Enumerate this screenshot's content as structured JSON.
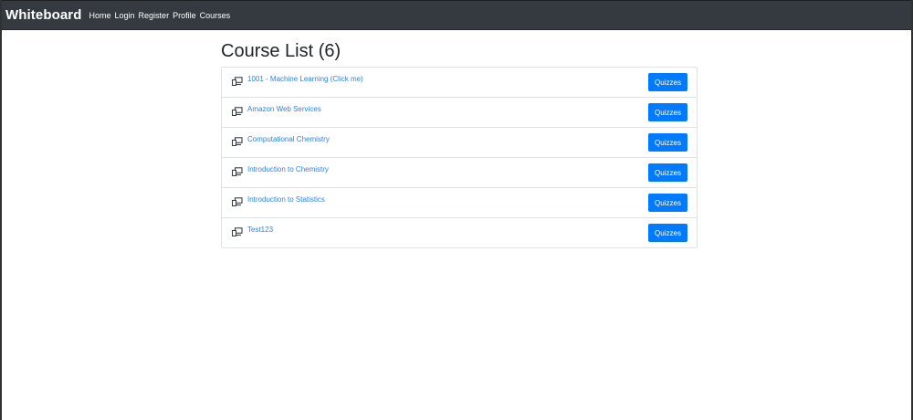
{
  "navbar": {
    "brand": "Whiteboard",
    "links": [
      "Home",
      "Login",
      "Register",
      "Profile",
      "Courses"
    ],
    "background": "#343a40"
  },
  "main": {
    "title": "Course List (6)",
    "courses": [
      {
        "name": "1001 - Machine Learning (Click me)",
        "icon": "laptop-icon",
        "button": "Quizzes"
      },
      {
        "name": "Amazon Web Services",
        "icon": "laptop-icon",
        "button": "Quizzes"
      },
      {
        "name": "Computational Chemistry",
        "icon": "laptop-icon",
        "button": "Quizzes"
      },
      {
        "name": "Introduction to Chemistry",
        "icon": "laptop-icon",
        "button": "Quizzes"
      },
      {
        "name": "Introduction to Statistics",
        "icon": "laptop-icon",
        "button": "Quizzes"
      },
      {
        "name": "Test123",
        "icon": "laptop-icon",
        "button": "Quizzes"
      }
    ]
  },
  "colors": {
    "accent": "#007bff",
    "link": "#2f80ed",
    "border": "#dee2e6"
  }
}
